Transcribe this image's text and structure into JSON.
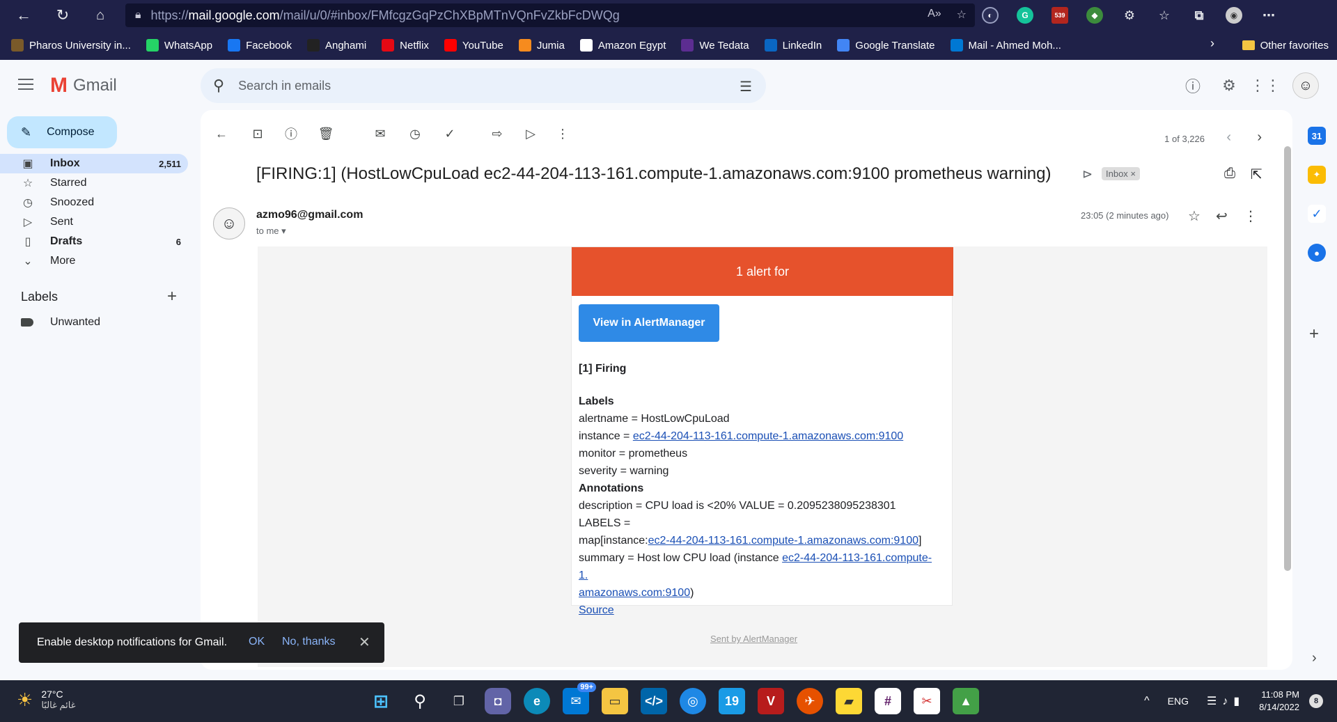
{
  "browser": {
    "url_prefix": "https://",
    "url_host": "mail.google.com",
    "url_path": "/mail/u/0/#inbox/FMfcgzGqPzChXBpMTnVQnFvZkbFcDWQg",
    "extension_badge": "539",
    "favorites": [
      {
        "label": "Pharos University in...",
        "color": "#7a5a2a"
      },
      {
        "label": "WhatsApp",
        "color": "#25d366"
      },
      {
        "label": "Facebook",
        "color": "#1877f2"
      },
      {
        "label": "Anghami",
        "color": "#222222"
      },
      {
        "label": "Netflix",
        "color": "#e50914"
      },
      {
        "label": "YouTube",
        "color": "#ff0000"
      },
      {
        "label": "Jumia",
        "color": "#f68b1e"
      },
      {
        "label": "Amazon Egypt",
        "color": "#ffffff"
      },
      {
        "label": "We Tedata",
        "color": "#5c2d91"
      },
      {
        "label": "LinkedIn",
        "color": "#0a66c2"
      },
      {
        "label": "Google Translate",
        "color": "#4285f4"
      },
      {
        "label": "Mail - Ahmed Moh...",
        "color": "#0078d4"
      }
    ],
    "other_favorites": "Other favorites"
  },
  "gmail": {
    "app_name": "Gmail",
    "search_placeholder": "Search in emails",
    "compose_label": "Compose",
    "nav": [
      {
        "label": "Inbox",
        "count": "2,511",
        "icon": "inbox-icon",
        "glyph": "▣"
      },
      {
        "label": "Starred",
        "count": "",
        "icon": "star-icon",
        "glyph": "☆"
      },
      {
        "label": "Snoozed",
        "count": "",
        "icon": "clock-icon",
        "glyph": "◷"
      },
      {
        "label": "Sent",
        "count": "",
        "icon": "send-icon",
        "glyph": "▷"
      },
      {
        "label": "Drafts",
        "count": "6",
        "icon": "draft-icon",
        "glyph": "▯"
      },
      {
        "label": "More",
        "count": "",
        "icon": "chevron-down-icon",
        "glyph": "⌄"
      }
    ],
    "labels_title": "Labels",
    "labels": [
      "Unwanted"
    ]
  },
  "message": {
    "pager": "1 of 3,226",
    "subject": "[FIRING:1] (HostLowCpuLoad ec2-44-204-113-161.compute-1.amazonaws.com:9100 prometheus warning)",
    "inbox_chip": "Inbox",
    "sender": "azmo96@gmail.com",
    "to": "to me",
    "time": "23:05 (2 minutes ago)",
    "alert_header": "1 alert for",
    "alertmanager_button": "View in AlertManager",
    "firing": "[1] Firing",
    "labels_heading": "Labels",
    "alertname": "alertname = HostLowCpuLoad",
    "instance_prefix": "instance = ",
    "instance_link": "ec2-44-204-113-161.compute-1.amazonaws.com:9100",
    "monitor": "monitor = prometheus",
    "severity": "severity = warning",
    "annotations_heading": "Annotations",
    "description_line1": "description = CPU load is <20% VALUE = 0.2095238095238301 LABELS =",
    "description_map_prefix": "map[instance:",
    "description_link": "ec2-44-204-113-161.compute-1.amazonaws.com:9100",
    "description_map_suffix": "]",
    "summary_prefix": "summary = Host low CPU load (instance ",
    "summary_link_a": "ec2-44-204-113-161.compute-1.",
    "summary_link_b": "amazonaws.com:9100",
    "summary_suffix": ")",
    "source": "Source",
    "sent_by": "Sent by AlertManager"
  },
  "snackbar": {
    "text": "Enable desktop notifications for Gmail.",
    "ok": "OK",
    "no": "No, thanks"
  },
  "taskbar": {
    "temp": "27°C",
    "condition": "غائم غالبًا",
    "lang": "ENG",
    "time": "11:08 PM",
    "date": "8/14/2022",
    "notif_count": "8",
    "mail_badge": "99+"
  }
}
